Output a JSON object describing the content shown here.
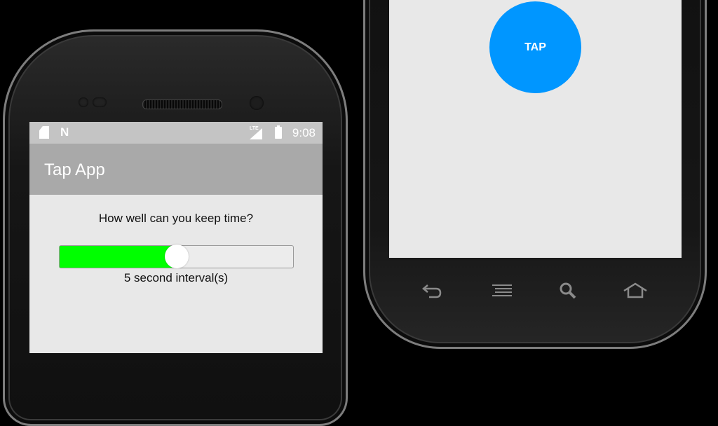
{
  "left_phone": {
    "status_bar": {
      "sd_icon": "sd-card-icon",
      "notification_icon": "N",
      "signal_badge": "LTE",
      "battery_icon": "battery-icon",
      "clock": "9:08"
    },
    "app_bar": {
      "title": "Tap App"
    },
    "content": {
      "question": "How well can you keep time?",
      "slider": {
        "value_fraction": 0.5,
        "fill_color": "#00ff00"
      },
      "interval_label": "5 second interval(s)"
    }
  },
  "right_phone": {
    "tap_button": {
      "label": "TAP",
      "color": "#0096ff"
    },
    "nav_keys": [
      "back-icon",
      "menu-icon",
      "search-icon",
      "home-icon"
    ]
  }
}
